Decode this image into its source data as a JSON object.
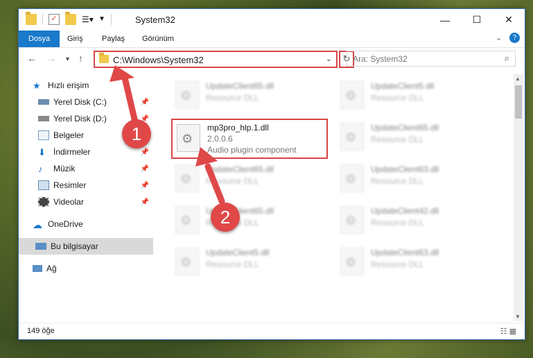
{
  "window": {
    "title": "System32"
  },
  "ribbon": {
    "tabs": [
      "Dosya",
      "Giriş",
      "Paylaş",
      "Görünüm"
    ]
  },
  "address": {
    "path": "C:\\Windows\\System32",
    "search_placeholder": "Ara: System32"
  },
  "nav": {
    "items": [
      {
        "label": "Hızlı erişim",
        "icon": "star-icon"
      },
      {
        "label": "Yerel Disk (C:)",
        "icon": "drive-icon"
      },
      {
        "label": "Yerel Disk (D:)",
        "icon": "drive-icon"
      },
      {
        "label": "Belgeler",
        "icon": "documents-icon"
      },
      {
        "label": "İndirmeler",
        "icon": "download-icon"
      },
      {
        "label": "Müzik",
        "icon": "music-icon"
      },
      {
        "label": "Resimler",
        "icon": "pictures-icon"
      },
      {
        "label": "Videolar",
        "icon": "video-icon"
      },
      {
        "label": "OneDrive",
        "icon": "cloud-icon"
      },
      {
        "label": "Bu bilgisayar",
        "icon": "computer-icon"
      },
      {
        "label": "Ağ",
        "icon": "network-icon"
      }
    ]
  },
  "files": [
    {
      "name": "UpdateClient65.dll",
      "desc": "Resource DLL"
    },
    {
      "name": "UpdateClient5.dll",
      "desc": "Resource DLL"
    },
    {
      "name": "mp3pro_hlp.1.dll",
      "desc": "Audio plugin component",
      "version": "2.0.0.6"
    },
    {
      "name": "UpdateClient65.dll",
      "desc": "Resource DLL"
    },
    {
      "name": "UpdateClient65.dll",
      "desc": "Resource DLL"
    },
    {
      "name": "UpdateClient63.dll",
      "desc": "Resource DLL"
    },
    {
      "name": "UpdateClient65.dll",
      "desc": "Resource DLL"
    },
    {
      "name": "UpdateClient42.dll",
      "desc": "Resource DLL"
    },
    {
      "name": "UpdateClient5.dll",
      "desc": "Resource DLL"
    },
    {
      "name": "UpdateClient63.dll",
      "desc": "Resource DLL"
    }
  ],
  "status": {
    "count": "149 öğe"
  },
  "badges": {
    "one": "1",
    "two": "2"
  },
  "colors": {
    "accent": "#1979ca",
    "highlight": "#d64545"
  }
}
